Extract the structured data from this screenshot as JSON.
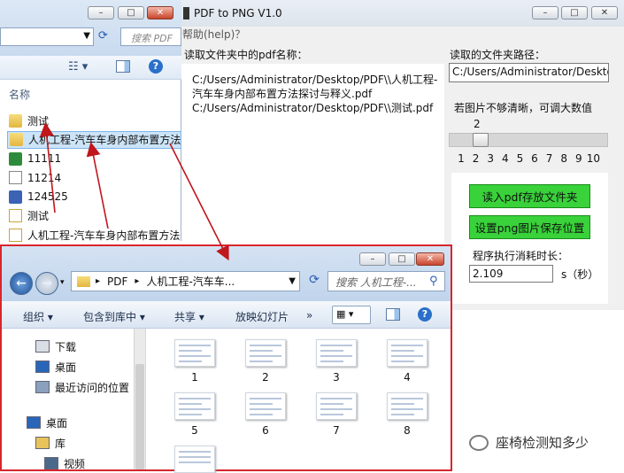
{
  "bg_explorer": {
    "search_placeholder": "搜索 PDF",
    "col_name": "名称",
    "files": [
      {
        "name": "测试",
        "type": "folder"
      },
      {
        "name": "人机工程-汽车车身内部布置方法",
        "type": "folder"
      },
      {
        "name": "11111",
        "type": "xls"
      },
      {
        "name": "11214",
        "type": "doc"
      },
      {
        "name": "124525",
        "type": "word"
      },
      {
        "name": "测试",
        "type": "pdf"
      },
      {
        "name": "人机工程-汽车车身内部布置方法",
        "type": "pdf"
      }
    ]
  },
  "app": {
    "title": "PDF to PNG V1.0",
    "menu_help": "帮助(help)？",
    "label_pdf_names": "读取文件夹中的pdf名称：",
    "label_folder_path": "读取的文件夹路径：",
    "pdf_lines": [
      "C:/Users/Administrator/Desktop/PDF\\\\人机工程-",
      "汽车车身内部布置方法探讨与释义.pdf",
      "C:/Users/Administrator/Desktop/PDF\\\\测试.pdf"
    ],
    "folder_path": "C:/Users/Administrator/Desktop",
    "hint": "若图片不够清晰，可调大数值",
    "slider_value": "2",
    "slider_ticks": [
      "1",
      "2",
      "3",
      "4",
      "5",
      "6",
      "7",
      "8",
      "9",
      "10"
    ],
    "btn_read": "读入pdf存放文件夹",
    "btn_save": "设置png图片保存位置",
    "time_label": "程序执行消耗时长：",
    "time_value": "2.109",
    "time_unit": "s（秒）"
  },
  "fg_explorer": {
    "breadcrumb": [
      "PDF",
      "人机工程-汽车车..."
    ],
    "search_placeholder": "搜索 人机工程-...",
    "toolbar": {
      "organize": "组织",
      "include": "包含到库中",
      "share": "共享",
      "slideshow": "放映幻灯片",
      "more": "»"
    },
    "nav": [
      {
        "label": "下载",
        "icon": "download-folder-icon"
      },
      {
        "label": "桌面",
        "icon": "desktop-icon"
      },
      {
        "label": "最近访问的位置",
        "icon": "recent-places-icon"
      },
      {
        "label": "桌面",
        "icon": "desktop-icon"
      },
      {
        "label": "库",
        "icon": "library-icon"
      },
      {
        "label": "视频",
        "icon": "video-icon"
      }
    ],
    "thumbs": [
      "1",
      "2",
      "3",
      "4",
      "5",
      "6",
      "7",
      "8"
    ]
  },
  "watermark": "座椅检测知多少",
  "colors": {
    "highlight_border": "#d8262c",
    "green_button": "#39d23a",
    "arrow": "#c0161c"
  }
}
